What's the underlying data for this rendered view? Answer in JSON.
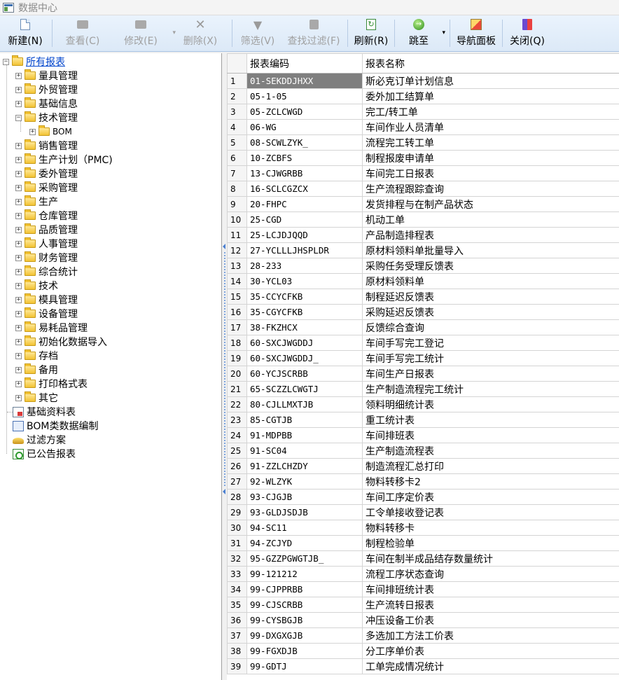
{
  "window": {
    "title": "数据中心"
  },
  "toolbar": {
    "new": "新建(N)",
    "view": "查看(C)",
    "edit": "修改(E)",
    "delete": "删除(X)",
    "filter": "筛选(V)",
    "find_filter": "查找过滤(F)",
    "refresh": "刷新(R)",
    "jump": "跳至",
    "nav_panel": "导航面板",
    "close": "关闭(Q)"
  },
  "tree": {
    "root": "所有报表",
    "groups": [
      "量具管理",
      "外贸管理",
      "基础信息",
      "技术管理",
      "BOM",
      "销售管理",
      "生产计划（PMC)",
      "委外管理",
      "采购管理",
      "生产",
      "仓库管理",
      "品质管理",
      "人事管理",
      "财务管理",
      "综合统计",
      "技术",
      "模具管理",
      "设备管理",
      "易耗品管理",
      "初始化数据导入",
      "存档",
      "备用",
      "打印格式表",
      "其它"
    ],
    "leaves": [
      "基础资料表",
      "BOM类数据编制",
      "过滤方案",
      "已公告报表"
    ]
  },
  "grid": {
    "columns": [
      "报表编码",
      "报表名称"
    ],
    "selected_row": 1,
    "rows": [
      [
        "1",
        "01-SEKDDJHXX",
        "斯必克订单计划信息"
      ],
      [
        "2",
        "05-1-05",
        "委外加工结算单"
      ],
      [
        "3",
        "05-ZCLCWGD",
        "完工/转工单"
      ],
      [
        "4",
        "06-WG",
        "车间作业人员清单"
      ],
      [
        "5",
        "08-SCWLZYK_",
        "流程完工转工单"
      ],
      [
        "6",
        "10-ZCBFS",
        "制程报废申请单"
      ],
      [
        "7",
        "13-CJWGRBB",
        "车间完工日报表"
      ],
      [
        "8",
        "16-SCLCGZCX",
        "生产流程跟踪查询"
      ],
      [
        "9",
        "20-FHPC",
        "发货排程与在制产品状态"
      ],
      [
        "10",
        "25-CGD",
        "机动工单"
      ],
      [
        "11",
        "25-LCJDJQQD",
        "产品制造排程表"
      ],
      [
        "12",
        "27-YCLLLJHSPLDR",
        "原材料领料单批量导入"
      ],
      [
        "13",
        "28-233",
        "采购任务受理反馈表"
      ],
      [
        "14",
        "30-YCL03",
        "原材料领料单"
      ],
      [
        "15",
        "35-CCYCFKB",
        "制程延迟反馈表"
      ],
      [
        "16",
        "35-CGYCFKB",
        "采购延迟反馈表"
      ],
      [
        "17",
        "38-FKZHCX",
        "反馈综合查询"
      ],
      [
        "18",
        "60-SXCJWGDDJ",
        "车间手写完工登记"
      ],
      [
        "19",
        "60-SXCJWGDDJ_",
        "车间手写完工统计"
      ],
      [
        "20",
        "60-YCJSCRBB",
        "车间生产日报表"
      ],
      [
        "21",
        "65-SCZZLCWGTJ",
        "生产制造流程完工统计"
      ],
      [
        "22",
        "80-CJLLMXTJB",
        "领料明细统计表"
      ],
      [
        "23",
        "85-CGTJB",
        "重工统计表"
      ],
      [
        "24",
        "91-MDPBB",
        "车间排班表"
      ],
      [
        "25",
        "91-SC04",
        "生产制造流程表"
      ],
      [
        "26",
        "91-ZZLCHZDY",
        "制造流程汇总打印"
      ],
      [
        "27",
        "92-WLZYK",
        "物料转移卡2"
      ],
      [
        "28",
        "93-CJGJB",
        "车间工序定价表"
      ],
      [
        "29",
        "93-GLDJSDJB",
        "工令单接收登记表"
      ],
      [
        "30",
        "94-SC11",
        "物料转移卡"
      ],
      [
        "31",
        "94-ZCJYD",
        "制程检验单"
      ],
      [
        "32",
        "95-GZZPGWGTJB_",
        "车间在制半成品结存数量统计"
      ],
      [
        "33",
        "99-121212",
        "流程工序状态查询"
      ],
      [
        "34",
        "99-CJPPRBB",
        "车间排班统计表"
      ],
      [
        "35",
        "99-CJSCRBB",
        "生产流转日报表"
      ],
      [
        "36",
        "99-CYSBGJB",
        "冲压设备工价表"
      ],
      [
        "37",
        "99-DXGXGJB",
        "多选加工方法工价表"
      ],
      [
        "38",
        "99-FGXDJB",
        "分工序单价表"
      ],
      [
        "39",
        "99-GDTJ",
        "工单完成情况统计"
      ]
    ]
  }
}
